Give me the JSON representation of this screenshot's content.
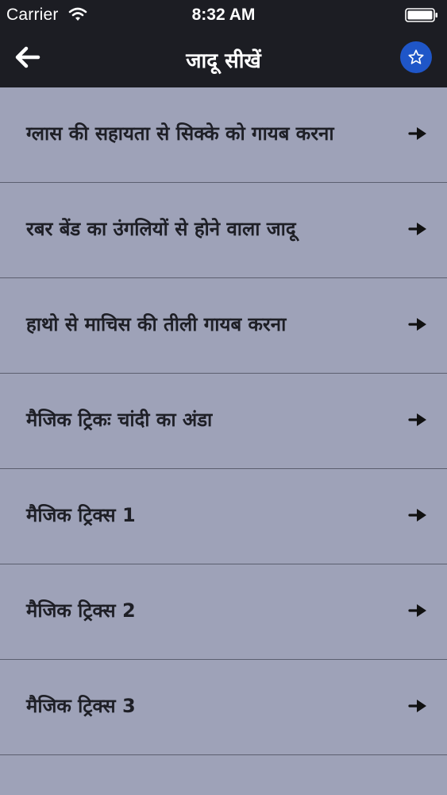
{
  "status_bar": {
    "carrier": "Carrier",
    "time": "8:32 AM",
    "wifi_icon": "wifi-icon",
    "battery_icon": "battery-icon"
  },
  "nav": {
    "title": "जादू सीखें",
    "back_icon": "back-arrow-icon",
    "favorite_icon": "star-icon"
  },
  "list": {
    "items": [
      {
        "label": "ग्लास की सहायता से सिक्के को गायब करना"
      },
      {
        "label": "रबर बेंड का उंगलियों से होने वाला जादू"
      },
      {
        "label": "हाथो से माचिस की तीली गायब करना"
      },
      {
        "label": "मैजिक ट्रिकः चांदी का अंडा"
      },
      {
        "label": "मैजिक ट्रिक्स 1"
      },
      {
        "label": "मैजिक ट्रिक्स 2"
      },
      {
        "label": "मैजिक ट्रिक्स 3"
      }
    ],
    "arrow_icon": "right-arrow-icon"
  },
  "colors": {
    "header_bg": "#1c1d23",
    "list_bg": "#9ea2b8",
    "divider": "#5c5f70",
    "accent": "#1f56c8",
    "text": "#1e1f26"
  }
}
